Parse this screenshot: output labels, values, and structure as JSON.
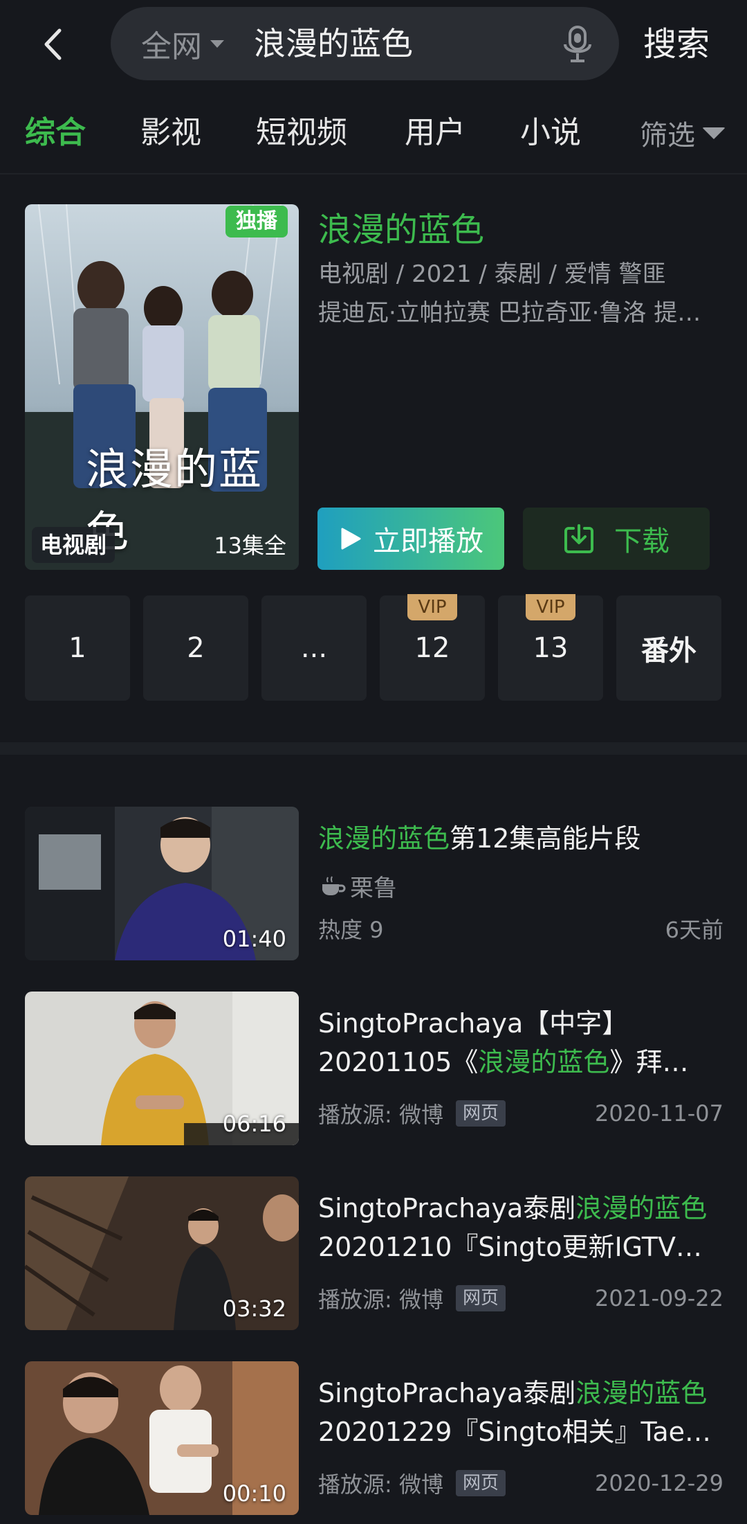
{
  "search": {
    "scope": "全网",
    "query": "浪漫的蓝色",
    "button": "搜索"
  },
  "tabs": [
    "综合",
    "影视",
    "短视频",
    "用户",
    "小说"
  ],
  "filter_label": "筛选",
  "featured": {
    "title": "浪漫的蓝色",
    "meta": "电视剧 / 2021 / 泰剧 / 爱情 警匪",
    "cast": "提迪瓦·立帕拉赛  巴拉奇亚·鲁洛  提…",
    "exclusive_badge": "独播",
    "type_badge": "电视剧",
    "episodes_total": "13集全",
    "poster_title": "浪漫的蓝色",
    "play_label": "立即播放",
    "download_label": "下载",
    "episodes": [
      {
        "label": "1",
        "vip": ""
      },
      {
        "label": "2",
        "vip": ""
      },
      {
        "label": "...",
        "vip": ""
      },
      {
        "label": "12",
        "vip": "VIP"
      },
      {
        "label": "13",
        "vip": "VIP"
      },
      {
        "label": "番外",
        "vip": ""
      }
    ]
  },
  "videos": [
    {
      "title_hl": "浪漫的蓝色",
      "title_rest": "第12集高能片段",
      "author": "栗鲁",
      "heat": "热度 9",
      "date": "6天前",
      "duration": "01:40"
    },
    {
      "line1": "SingtoPrachaya【中字】",
      "line2_pre": "20201105《",
      "line2_hl": "浪漫的蓝色",
      "line2_post": "》拜…",
      "source": "播放源: 微博",
      "badge": "网页",
      "date": "2020-11-07",
      "duration": "06:16"
    },
    {
      "line1_pre": "SingtoPrachaya泰剧",
      "line1_hl": "浪漫的蓝色",
      "line2": "20201210『Singto更新IGTV…",
      "source": "播放源: 微博",
      "badge": "网页",
      "date": "2021-09-22",
      "duration": "03:32"
    },
    {
      "line1_pre": "SingtoPrachaya泰剧",
      "line1_hl": "浪漫的蓝色",
      "line2": "20201229『Singto相关』Tae…",
      "source": "播放源: 微博",
      "badge": "网页",
      "date": "2020-12-29",
      "duration": "00:10"
    }
  ],
  "colors": {
    "accent": "#3dbb4e",
    "background": "#16181d",
    "vip": "#d4a76a"
  },
  "icons": [
    "back-chevron-icon",
    "mic-icon",
    "play-icon",
    "download-icon",
    "coffee-cup-icon"
  ]
}
